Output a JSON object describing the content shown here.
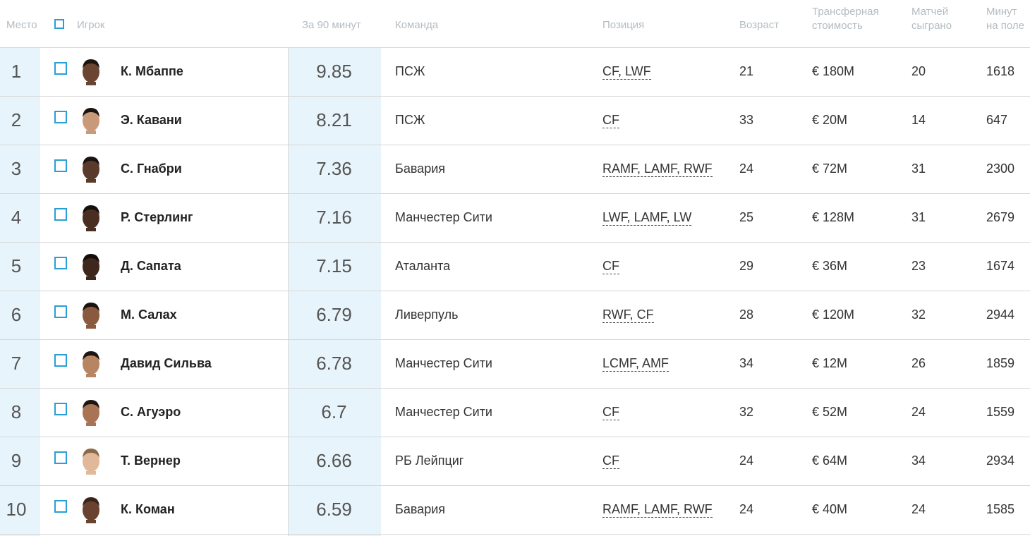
{
  "header": {
    "rank": "Место",
    "player": "Игрок",
    "per90": "За 90 минут",
    "team": "Команда",
    "position": "Позиция",
    "age": "Возраст",
    "value_line1": "Трансферная",
    "value_line2": "стоимость",
    "matches_line1": "Матчей",
    "matches_line2": "сыграно",
    "minutes_line1": "Минут",
    "minutes_line2": "на поле"
  },
  "rows": [
    {
      "rank": "1",
      "name": "К. Мбаппе",
      "score": "9.85",
      "team": "ПСЖ",
      "position": "CF, LWF",
      "age": "21",
      "value": "€ 180M",
      "matches": "20",
      "minutes": "1618",
      "skin": "#6b4532",
      "hair": "#1d1410"
    },
    {
      "rank": "2",
      "name": "Э. Кавани",
      "score": "8.21",
      "team": "ПСЖ",
      "position": "CF",
      "age": "33",
      "value": "€ 20M",
      "matches": "14",
      "minutes": "647",
      "skin": "#c99a79",
      "hair": "#1a130f"
    },
    {
      "rank": "3",
      "name": "С. Гнабри",
      "score": "7.36",
      "team": "Бавария",
      "position": "RAMF, LAMF, RWF",
      "age": "24",
      "value": "€ 72M",
      "matches": "31",
      "minutes": "2300",
      "skin": "#5a3a2a",
      "hair": "#1a1210"
    },
    {
      "rank": "4",
      "name": "Р. Стерлинг",
      "score": "7.16",
      "team": "Манчестер Сити",
      "position": "LWF, LAMF, LW",
      "age": "25",
      "value": "€ 128M",
      "matches": "31",
      "minutes": "2679",
      "skin": "#4a2e22",
      "hair": "#16100d"
    },
    {
      "rank": "5",
      "name": "Д. Сапата",
      "score": "7.15",
      "team": "Аталанта",
      "position": "CF",
      "age": "29",
      "value": "€ 36M",
      "matches": "23",
      "minutes": "1674",
      "skin": "#3e271d",
      "hair": "#140e0b"
    },
    {
      "rank": "6",
      "name": "М. Салах",
      "score": "6.79",
      "team": "Ливерпуль",
      "position": "RWF, CF",
      "age": "28",
      "value": "€ 120M",
      "matches": "32",
      "minutes": "2944",
      "skin": "#8a5a3e",
      "hair": "#1b1310"
    },
    {
      "rank": "7",
      "name": "Давид Сильва",
      "score": "6.78",
      "team": "Манчестер Сити",
      "position": "LCMF, AMF",
      "age": "34",
      "value": "€ 12M",
      "matches": "26",
      "minutes": "1859",
      "skin": "#b88563",
      "hair": "#1c1410"
    },
    {
      "rank": "8",
      "name": "С. Агуэро",
      "score": "6.7",
      "team": "Манчестер Сити",
      "position": "CF",
      "age": "32",
      "value": "€ 52M",
      "matches": "24",
      "minutes": "1559",
      "skin": "#a87455",
      "hair": "#1d1511"
    },
    {
      "rank": "9",
      "name": "Т. Вернер",
      "score": "6.66",
      "team": "РБ Лейпциг",
      "position": "CF",
      "age": "24",
      "value": "€ 64M",
      "matches": "34",
      "minutes": "2934",
      "skin": "#e2b89a",
      "hair": "#8a6a4a"
    },
    {
      "rank": "10",
      "name": "К. Коман",
      "score": "6.59",
      "team": "Бавария",
      "position": "RAMF, LAMF, RWF",
      "age": "24",
      "value": "€ 40M",
      "matches": "24",
      "minutes": "1585",
      "skin": "#6a4330",
      "hair": "#3a2418"
    }
  ]
}
